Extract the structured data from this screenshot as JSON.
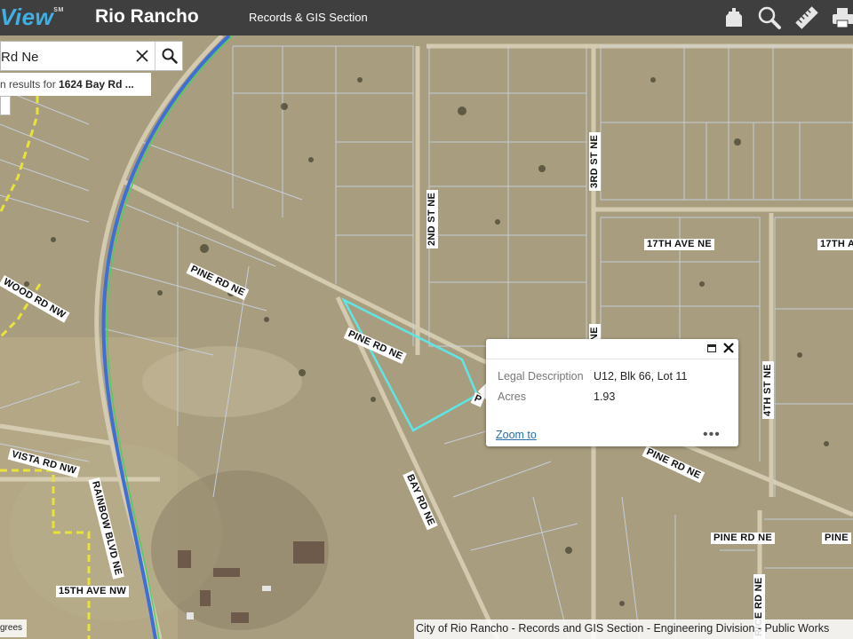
{
  "header": {
    "brand": "View",
    "brand_sup": "SM",
    "city": "Rio Rancho",
    "section": "Records & GIS Section"
  },
  "search": {
    "value": "Rd Ne",
    "results_prefix": "n results for ",
    "results_query": "1624 Bay Rd ..."
  },
  "popup": {
    "rows": [
      {
        "label": "Legal Description",
        "value": "U12, Blk 66, Lot 11"
      },
      {
        "label": "Acres",
        "value": "1.93"
      }
    ],
    "zoom_label": "Zoom to",
    "more_label": "•••"
  },
  "roads": {
    "pine1": "PINE RD NE",
    "pine2": "PINE RD NE",
    "pine3": "PINE RD NE",
    "pine4": "PINE RD NE",
    "pine5": "PINE RD NE",
    "pine6": "PINE",
    "second_st": "2ND ST NE",
    "third_st": "3RD ST NE",
    "third_st_b": "RD ST NE",
    "fourth_st": "4TH ST NE",
    "seventeenth": "17TH AVE NE",
    "seventeenth_b": "17TH A",
    "wood": "WOOD RD NW",
    "vista": "VISTA RD NW",
    "rainbow": "RAINBOW BLVD NE",
    "bay": "BAY RD NE",
    "fifteenth": "15TH AVE NW",
    "rice": "RICE RD NE"
  },
  "footer": {
    "attribution": "City of Rio Rancho - Records and GIS Section - Engineering Division - Public Works",
    "scale_unit": "grees"
  },
  "colors": {
    "header_bg": "#3f3f3f",
    "brand": "#3fb0e6",
    "parcel_highlight": "#5ee6e6",
    "parcel_lines": "#c9d3e6",
    "link": "#2a6ea8"
  }
}
